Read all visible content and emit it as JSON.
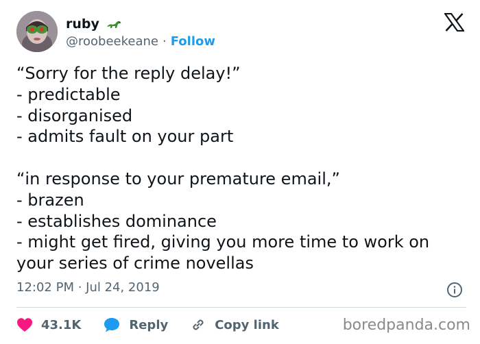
{
  "author": {
    "name": "ruby",
    "handle": "@roobeekeane",
    "separator": "·",
    "follow_label": "Follow"
  },
  "tweet": {
    "lines": [
      "“Sorry for the reply delay!”",
      "- predictable",
      "- disorganised",
      "- admits fault on your part",
      "",
      "“in response to your premature email,”",
      "- brazen",
      "- establishes dominance",
      "- might get fired, giving you more time to work on",
      "your series of crime novellas"
    ],
    "timestamp": "12:02 PM · Jul 24, 2019"
  },
  "actions": {
    "likes": "43.1K",
    "reply_label": "Reply",
    "copy_link_label": "Copy link"
  },
  "watermark": "boredpanda.com",
  "colors": {
    "accent": "#1d9bf0",
    "like": "#f91880",
    "text": "#0f1419",
    "muted": "#536471",
    "divider": "#cfd9de"
  },
  "icons": [
    "dinosaur-icon",
    "x-logo-icon",
    "info-icon",
    "heart-icon",
    "reply-bubble-icon",
    "link-icon"
  ]
}
